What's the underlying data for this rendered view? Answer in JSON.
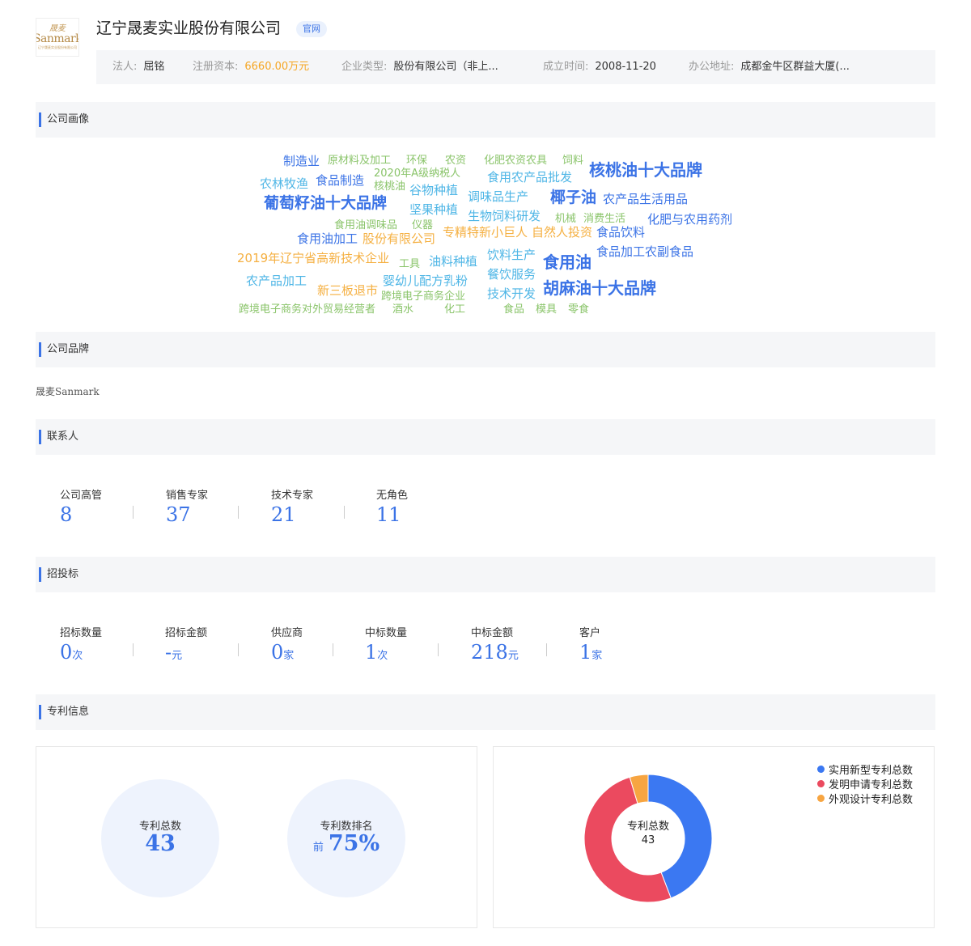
{
  "logo": {
    "cn": "晟麦",
    "en": "Sanmark",
    "sub": "辽宁晟麦实业股份有限公司"
  },
  "company": {
    "name": "辽宁晟麦实业股份有限公司",
    "badge": "官网"
  },
  "info": [
    {
      "label": "法人:",
      "value": "屈铭",
      "highlight": false
    },
    {
      "label": "注册资本:",
      "value": "6660.00万元",
      "highlight": true
    },
    {
      "label": "企业类型:",
      "value": "股份有限公司（非上...",
      "highlight": false
    },
    {
      "label": "成立时间:",
      "value": "2008-11-20",
      "highlight": false
    },
    {
      "label": "办公地址:",
      "value": "成都金牛区群益大厦(...",
      "highlight": false
    }
  ],
  "sections": {
    "portrait": "公司画像",
    "brand": "公司品牌",
    "contacts": "联系人",
    "bidding": "招投标",
    "patents": "专利信息"
  },
  "colors": {
    "blue": "#3b73e6",
    "lightblue": "#4fb6e6",
    "green": "#8ac46a",
    "orange": "#f5b042",
    "accent": "#3b73e6",
    "pie_utility": "#3b78f2",
    "pie_invention": "#eb4a5f",
    "pie_design": "#f7a541"
  },
  "word_cloud": [
    {
      "text": "制造业",
      "color": "blue"
    },
    {
      "text": "原材料及加工",
      "color": "green"
    },
    {
      "text": "环保",
      "color": "green"
    },
    {
      "text": "农资",
      "color": "green"
    },
    {
      "text": "化肥农资农具",
      "color": "green"
    },
    {
      "text": "饲料",
      "color": "green"
    },
    {
      "text": "核桃油十大品牌",
      "color": "blue"
    },
    {
      "text": "2020年A级纳税人",
      "color": "green"
    },
    {
      "text": "农林牧渔",
      "color": "lightblue"
    },
    {
      "text": "食品制造",
      "color": "blue"
    },
    {
      "text": "核桃油",
      "color": "green"
    },
    {
      "text": "食用农产品批发",
      "color": "lightblue"
    },
    {
      "text": "谷物种植",
      "color": "lightblue"
    },
    {
      "text": "葡萄籽油十大品牌",
      "color": "blue"
    },
    {
      "text": "调味品生产",
      "color": "lightblue"
    },
    {
      "text": "椰子油",
      "color": "blue"
    },
    {
      "text": "农产品生活用品",
      "color": "blue"
    },
    {
      "text": "坚果种植",
      "color": "lightblue"
    },
    {
      "text": "生物饲料研发",
      "color": "lightblue"
    },
    {
      "text": "机械",
      "color": "green"
    },
    {
      "text": "消费生活",
      "color": "green"
    },
    {
      "text": "化肥与农用药剂",
      "color": "blue"
    },
    {
      "text": "食用油调味品",
      "color": "green"
    },
    {
      "text": "仪器",
      "color": "green"
    },
    {
      "text": "专精特新小巨人",
      "color": "orange"
    },
    {
      "text": "自然人投资",
      "color": "orange"
    },
    {
      "text": "食品饮料",
      "color": "blue"
    },
    {
      "text": "食用油加工",
      "color": "blue"
    },
    {
      "text": "股份有限公司",
      "color": "orange"
    },
    {
      "text": "饮料生产",
      "color": "lightblue"
    },
    {
      "text": "食品加工农副食品",
      "color": "blue"
    },
    {
      "text": "2019年辽宁省高新技术企业",
      "color": "orange"
    },
    {
      "text": "工具",
      "color": "green"
    },
    {
      "text": "油料种植",
      "color": "lightblue"
    },
    {
      "text": "食用油",
      "color": "blue"
    },
    {
      "text": "餐饮服务",
      "color": "lightblue"
    },
    {
      "text": "农产品加工",
      "color": "lightblue"
    },
    {
      "text": "婴幼儿配方乳粉",
      "color": "lightblue"
    },
    {
      "text": "新三板退市",
      "color": "orange"
    },
    {
      "text": "跨境电子商务企业",
      "color": "green"
    },
    {
      "text": "技术开发",
      "color": "lightblue"
    },
    {
      "text": "胡麻油十大品牌",
      "color": "blue"
    },
    {
      "text": "跨境电子商务对外贸易经营者",
      "color": "green"
    },
    {
      "text": "酒水",
      "color": "green"
    },
    {
      "text": "化工",
      "color": "green"
    },
    {
      "text": "食品",
      "color": "green"
    },
    {
      "text": "模具",
      "color": "green"
    },
    {
      "text": "零食",
      "color": "green"
    }
  ],
  "brand": {
    "name": "晟麦Sanmark"
  },
  "contacts": [
    {
      "label": "公司高管",
      "value": "8",
      "unit": ""
    },
    {
      "label": "销售专家",
      "value": "37",
      "unit": ""
    },
    {
      "label": "技术专家",
      "value": "21",
      "unit": ""
    },
    {
      "label": "无角色",
      "value": "11",
      "unit": ""
    }
  ],
  "bidding": [
    {
      "label": "招标数量",
      "value": "0",
      "unit": "次"
    },
    {
      "label": "招标金额",
      "value": "-",
      "unit": "元"
    },
    {
      "label": "供应商",
      "value": "0",
      "unit": "家"
    },
    {
      "label": "中标数量",
      "value": "1",
      "unit": "次"
    },
    {
      "label": "中标金额",
      "value": "218",
      "unit": "元"
    },
    {
      "label": "客户",
      "value": "1",
      "unit": "家"
    }
  ],
  "patents": {
    "total_label": "专利总数",
    "total_value": "43",
    "rank_label": "专利数排名",
    "rank_prefix": "前",
    "rank_value": "75%",
    "donut_center_label": "专利总数",
    "donut_center_value": "43"
  },
  "chart_data": {
    "type": "pie",
    "donut": true,
    "title": "",
    "categories": [
      "实用新型专利总数",
      "发明申请专利总数",
      "外观设计专利总数"
    ],
    "values": [
      19,
      22,
      2
    ],
    "colors": [
      "#3b78f2",
      "#eb4a5f",
      "#f7a541"
    ],
    "legend_position": "top-right"
  }
}
